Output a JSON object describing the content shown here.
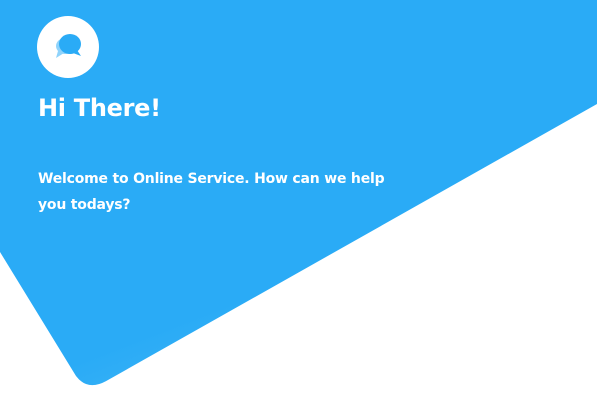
{
  "colors": {
    "header_background": "#2AABF6",
    "text": "#ffffff",
    "page_background": "#ffffff"
  },
  "header": {
    "icon": "chat-bubble-icon",
    "title": "Hi There!",
    "message": "Welcome to Online Service. How can we help you todays?"
  }
}
